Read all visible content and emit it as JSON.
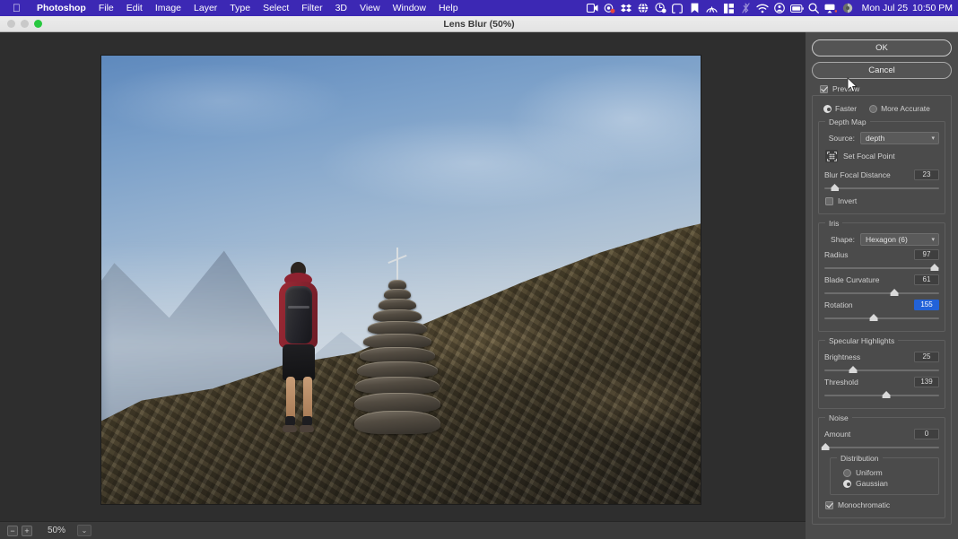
{
  "menubar": {
    "apple_icon": "apple-logo",
    "items": [
      {
        "label": "Photoshop",
        "bold": true
      },
      {
        "label": "File",
        "bold": false
      },
      {
        "label": "Edit",
        "bold": false
      },
      {
        "label": "Image",
        "bold": false
      },
      {
        "label": "Layer",
        "bold": false
      },
      {
        "label": "Type",
        "bold": false
      },
      {
        "label": "Select",
        "bold": false
      },
      {
        "label": "Filter",
        "bold": false
      },
      {
        "label": "3D",
        "bold": false
      },
      {
        "label": "View",
        "bold": false
      },
      {
        "label": "Window",
        "bold": false
      },
      {
        "label": "Help",
        "bold": false
      }
    ],
    "status_icons": [
      "screen-recording-icon",
      "camera-badge-icon",
      "dropbox-icon",
      "globe-icon",
      "clock-badge-icon",
      "screenshot-frame-icon",
      "bookmark-icon",
      "nordvpn-icon",
      "columns-icon",
      "bluetooth-off-icon",
      "wifi-icon",
      "user-account-icon",
      "battery-icon",
      "search-icon",
      "airplay-icon",
      "control-center-icon"
    ],
    "clock_day": "Mon Jul 25",
    "clock_time": "10:50 PM",
    "background_color": "#3c28b4"
  },
  "titlebar": {
    "title": "Lens Blur (50%)",
    "traffic_lights": [
      "close",
      "minimize",
      "zoom"
    ],
    "active_light_color": "#28c840"
  },
  "statusbar": {
    "zoom_out_label": "−",
    "zoom_in_label": "+",
    "zoom_value": "50%",
    "dropdown_caret": "⌄"
  },
  "panel": {
    "ok_label": "OK",
    "cancel_label": "Cancel",
    "preview": {
      "label": "Preview",
      "checked": true
    },
    "render_quality": {
      "faster_label": "Faster",
      "more_accurate_label": "More Accurate",
      "selected": "Faster"
    },
    "depth_map": {
      "legend": "Depth Map",
      "source_label": "Source:",
      "source_value": "depth",
      "set_focal_point_label": "Set Focal Point",
      "set_focal_point_icon": "focal-point-grid-icon",
      "blur_focal_distance": {
        "label": "Blur Focal Distance",
        "value": "23",
        "percent": 9
      },
      "invert": {
        "label": "Invert",
        "checked": false
      }
    },
    "iris": {
      "legend": "Iris",
      "shape_label": "Shape:",
      "shape_value": "Hexagon (6)",
      "radius": {
        "label": "Radius",
        "value": "97",
        "percent": 96
      },
      "blade_curvature": {
        "label": "Blade Curvature",
        "value": "61",
        "percent": 61
      },
      "rotation": {
        "label": "Rotation",
        "value": "155",
        "percent": 43,
        "selected": true
      }
    },
    "specular_highlights": {
      "legend": "Specular Highlights",
      "brightness": {
        "label": "Brightness",
        "value": "25",
        "percent": 25
      },
      "threshold": {
        "label": "Threshold",
        "value": "139",
        "percent": 54
      }
    },
    "noise": {
      "legend": "Noise",
      "amount": {
        "label": "Amount",
        "value": "0",
        "percent": 1
      },
      "distribution": {
        "legend": "Distribution",
        "uniform_label": "Uniform",
        "gaussian_label": "Gaussian",
        "selected": "Gaussian"
      },
      "monochromatic": {
        "label": "Monochromatic",
        "checked": true
      }
    }
  },
  "canvas": {
    "description": "Hiker with red jacket and black backpack standing beside a stone cairn on a mountain ridge, blurred alpine background",
    "zoom_level": "50%"
  }
}
